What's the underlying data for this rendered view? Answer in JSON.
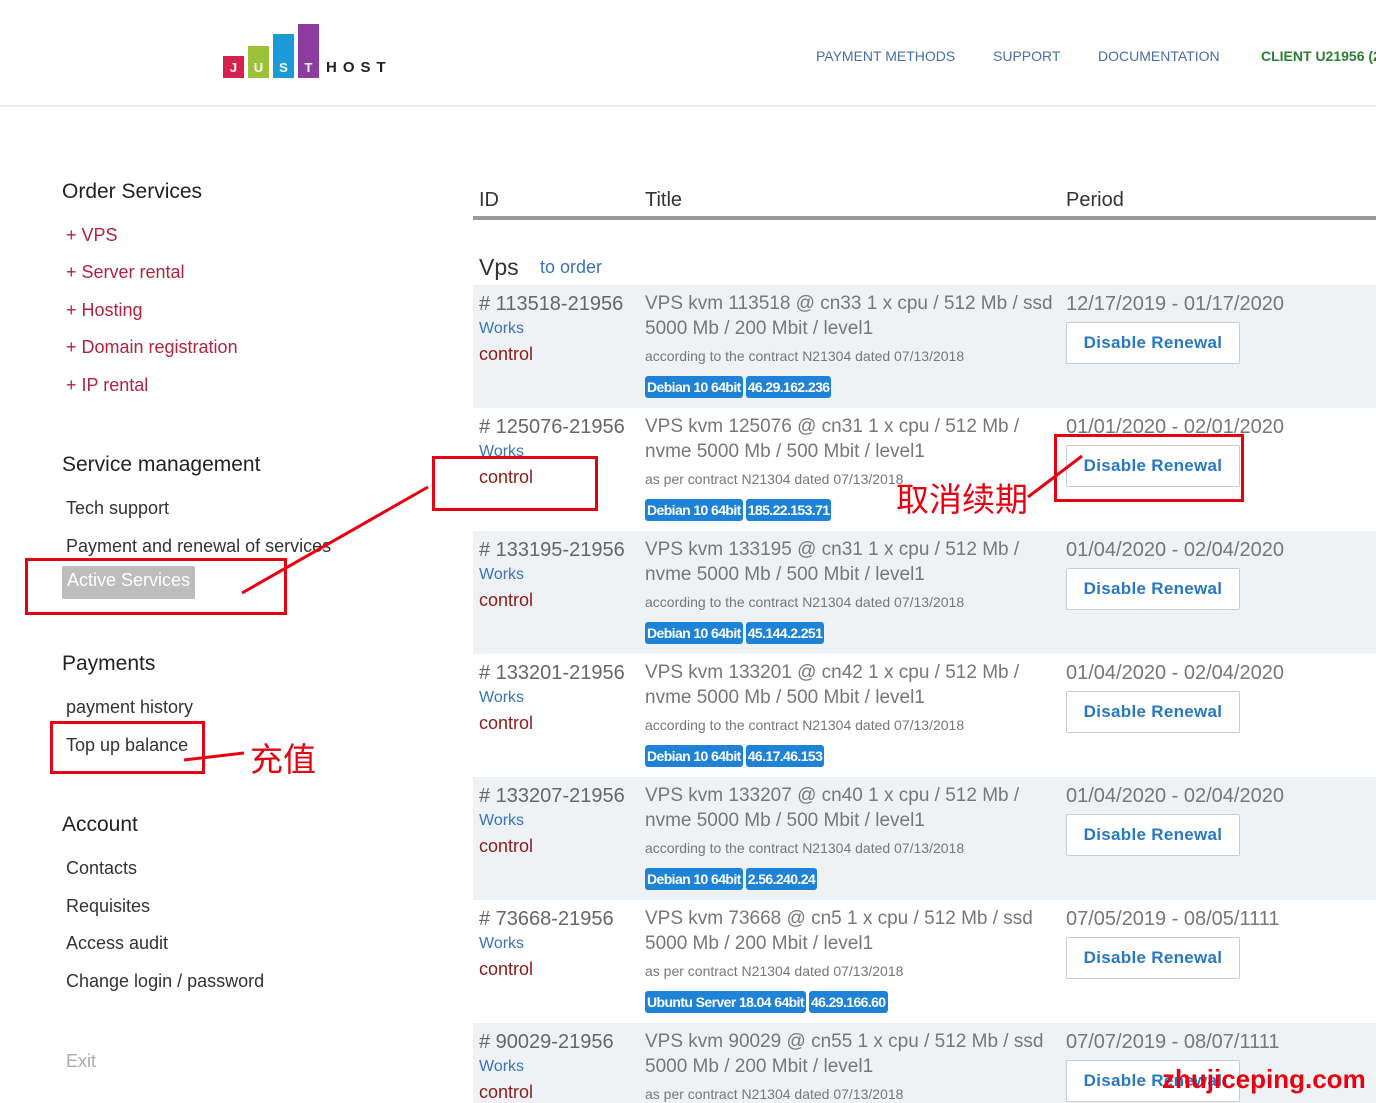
{
  "header": {
    "logo_letters": [
      "J",
      "U",
      "S",
      "T"
    ],
    "logo_word": "HOST",
    "nav": [
      {
        "label": "PAYMENT METHODS"
      },
      {
        "label": "SUPPORT"
      },
      {
        "label": "DOCUMENTATION"
      },
      {
        "label": "CLIENT U21956 (2"
      }
    ]
  },
  "sidebar": {
    "order_heading": "Order Services",
    "order_items": [
      "+ VPS",
      "+ Server rental",
      "+ Hosting",
      "+ Domain registration",
      "+ IP rental"
    ],
    "management_heading": "Service management",
    "management_items": [
      "Tech support",
      "Payment and renewal of services"
    ],
    "active_item": "Active Services",
    "payments_heading": "Payments",
    "payments_items": [
      "payment history",
      "Top up balance"
    ],
    "account_heading": "Account",
    "account_items": [
      "Contacts",
      "Requisites",
      "Access audit",
      "Change login / password"
    ],
    "exit": "Exit"
  },
  "table": {
    "headers": [
      "ID",
      "Title",
      "Period"
    ],
    "section_title": "Vps",
    "section_link": "to order",
    "rows": [
      {
        "id": "# 113518-21956",
        "status": "Works",
        "control": "control",
        "title1": "VPS kvm 113518 @ cn33 1 x cpu / 512 Mb / ssd",
        "title2": "5000 Mb / 200 Mbit / level1",
        "contract": "according to the contract N21304 dated 07/13/2018",
        "os": "Debian 10 64bit",
        "ip": "46.29.162.236",
        "period": "12/17/2019 - 01/17/2020",
        "button": "Disable Renewal"
      },
      {
        "id": "# 125076-21956",
        "status": "Works",
        "control": "control",
        "title1": "VPS kvm 125076 @ cn31 1 x cpu / 512 Mb /",
        "title2": "nvme 5000 Mb / 500 Mbit / level1",
        "contract": "as per contract N21304 dated 07/13/2018",
        "os": "Debian 10 64bit",
        "ip": "185.22.153.71",
        "period": "01/01/2020 - 02/01/2020",
        "button": "Disable Renewal"
      },
      {
        "id": "# 133195-21956",
        "status": "Works",
        "control": "control",
        "title1": "VPS kvm 133195 @ cn31 1 x cpu / 512 Mb /",
        "title2": "nvme 5000 Mb / 500 Mbit / level1",
        "contract": "according to the contract N21304 dated 07/13/2018",
        "os": "Debian 10 64bit",
        "ip": "45.144.2.251",
        "period": "01/04/2020 - 02/04/2020",
        "button": "Disable Renewal"
      },
      {
        "id": "# 133201-21956",
        "status": "Works",
        "control": "control",
        "title1": "VPS kvm 133201 @ cn42 1 x cpu / 512 Mb /",
        "title2": "nvme 5000 Mb / 500 Mbit / level1",
        "contract": "according to the contract N21304 dated 07/13/2018",
        "os": "Debian 10 64bit",
        "ip": "46.17.46.153",
        "period": "01/04/2020 - 02/04/2020",
        "button": "Disable Renewal"
      },
      {
        "id": "# 133207-21956",
        "status": "Works",
        "control": "control",
        "title1": "VPS kvm 133207 @ cn40 1 x cpu / 512 Mb /",
        "title2": "nvme 5000 Mb / 500 Mbit / level1",
        "contract": "according to the contract N21304 dated 07/13/2018",
        "os": "Debian 10 64bit",
        "ip": "2.56.240.24",
        "period": "01/04/2020 - 02/04/2020",
        "button": "Disable Renewal"
      },
      {
        "id": "# 73668-21956",
        "status": "Works",
        "control": "control",
        "title1": "VPS kvm 73668 @ cn5 1 x cpu / 512 Mb / ssd",
        "title2": "5000 Mb / 200 Mbit / level1",
        "contract": "as per contract N21304 dated 07/13/2018",
        "os": "Ubuntu Server 18.04 64bit",
        "ip": "46.29.166.60",
        "period": "07/05/2019 - 08/05/1111",
        "button": "Disable Renewal"
      },
      {
        "id": "# 90029-21956",
        "status": "Works",
        "control": "control",
        "title1": "VPS kvm 90029 @ cn55 1 x cpu / 512 Mb / ssd",
        "title2": "5000 Mb / 200 Mbit / level1",
        "contract": "as per contract N21304 dated 07/13/2018",
        "os": "",
        "ip": "",
        "period": "07/07/2019 - 08/07/1111",
        "button": "Disable Renewal"
      }
    ]
  },
  "annotations": {
    "cancel_renewal": "取消续期",
    "top_up": "充值",
    "watermark": "zhujiceping.com"
  },
  "colors": {
    "annotation": "#e60012",
    "link_blue": "#3b73b9",
    "order_red": "#b0243d",
    "tag_blue": "#1e82d6",
    "row_shade": "#eef2f5"
  }
}
